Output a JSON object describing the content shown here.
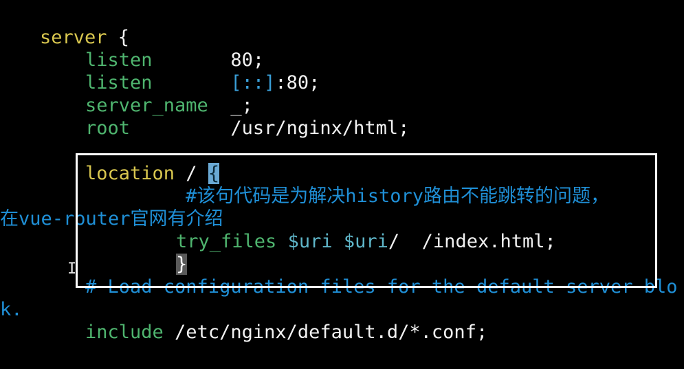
{
  "editor": {
    "lines": [
      {
        "id": "server",
        "parts": [
          {
            "t": "server",
            "c": "kw-yellow"
          },
          {
            "t": " {",
            "c": "txt-white"
          }
        ]
      },
      {
        "id": "listen1",
        "parts": [
          {
            "t": "listen",
            "c": "kw-green"
          },
          {
            "t": "       80;",
            "c": "txt-white"
          }
        ]
      },
      {
        "id": "listen2",
        "parts": [
          {
            "t": "listen",
            "c": "kw-green"
          },
          {
            "t": "       ",
            "c": "txt-white"
          },
          {
            "t": "[::]",
            "c": "txt-blue"
          },
          {
            "t": ":80;",
            "c": "txt-white"
          }
        ]
      },
      {
        "id": "server_name",
        "parts": [
          {
            "t": "server_name",
            "c": "kw-green"
          },
          {
            "t": "  _;",
            "c": "txt-white"
          }
        ]
      },
      {
        "id": "root",
        "parts": [
          {
            "t": "root",
            "c": "kw-green"
          },
          {
            "t": "         /usr/nginx/html;",
            "c": "txt-white"
          }
        ]
      },
      {
        "id": "location",
        "parts": [
          {
            "t": "location",
            "c": "kw-yellow"
          },
          {
            "t": " / ",
            "c": "txt-white"
          },
          {
            "t": "{",
            "c": "brace-hl"
          }
        ]
      },
      {
        "id": "comment1",
        "parts": [
          {
            "t": "#该句代码是为解决history路由不能跳转的问题，",
            "c": "comment"
          }
        ]
      },
      {
        "id": "comment1b",
        "parts": [
          {
            "t": "在vue-router官网有介绍",
            "c": "comment"
          }
        ]
      },
      {
        "id": "try_files",
        "parts": [
          {
            "t": "try_files",
            "c": "kw-green"
          },
          {
            "t": " ",
            "c": "txt-white"
          },
          {
            "t": "$uri",
            "c": "txt-teal"
          },
          {
            "t": " ",
            "c": "txt-white"
          },
          {
            "t": "$uri",
            "c": "txt-teal"
          },
          {
            "t": "/  /index.html;",
            "c": "txt-white"
          }
        ]
      },
      {
        "id": "close_brace",
        "parts": [
          {
            "t": "}",
            "c": "brace-hl-grey"
          }
        ]
      },
      {
        "id": "comment2",
        "parts": [
          {
            "t": "# Load configuration files for the default server blo",
            "c": "comment"
          }
        ]
      },
      {
        "id": "comment2b",
        "parts": [
          {
            "t": "k.",
            "c": "comment"
          }
        ]
      },
      {
        "id": "include",
        "parts": [
          {
            "t": "include",
            "c": "kw-green"
          },
          {
            "t": " /etc/nginx/default.d/*.conf;",
            "c": "txt-white"
          }
        ]
      }
    ]
  },
  "cursor_glyph": "I"
}
